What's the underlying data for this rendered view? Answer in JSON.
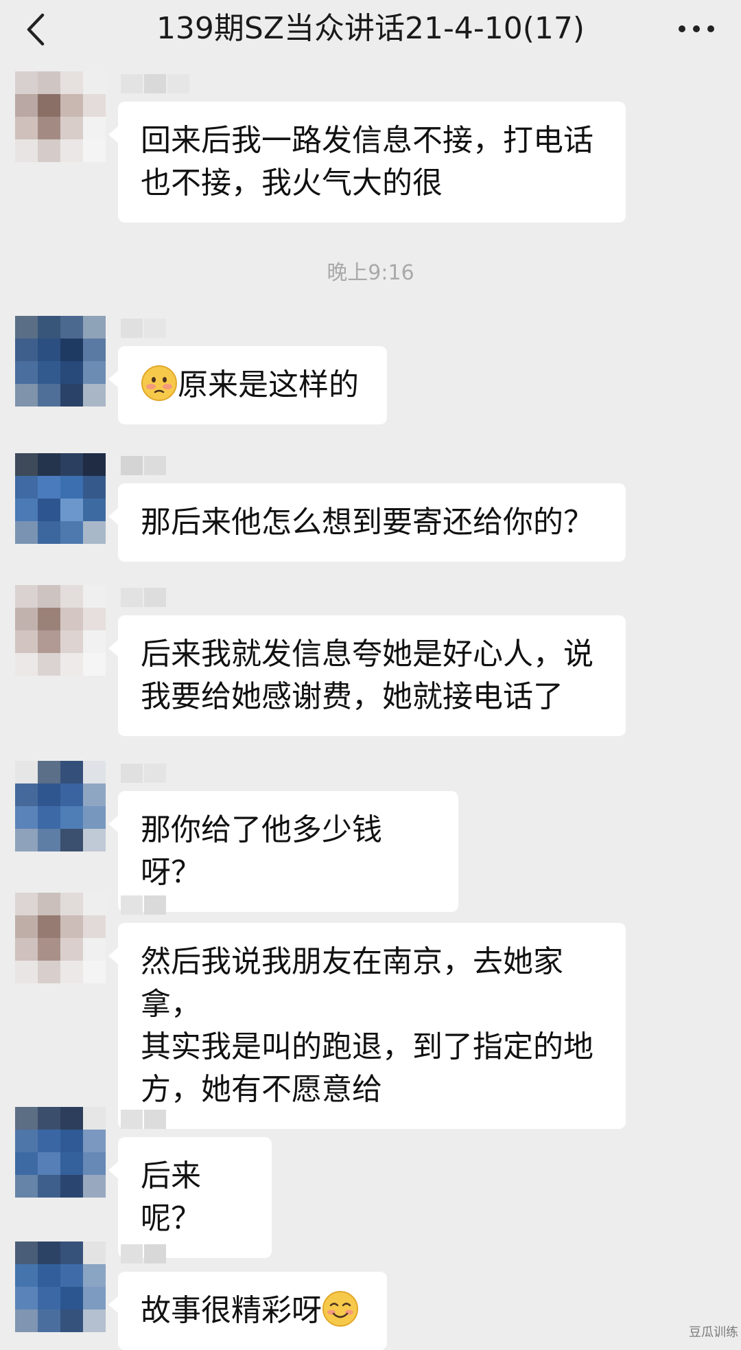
{
  "header": {
    "title": "139期SZ当众讲话21-4-10(17)",
    "back_icon": "chevron-left-icon",
    "more_icon": "ellipsis-icon"
  },
  "timestamp": "晚上9:16",
  "messages": [
    {
      "text": "回来后我一路发信息不接，打电话\n也不接，我火气大的很"
    },
    {
      "text": "原来是这样的",
      "emoji": "flushed-face-emoji"
    },
    {
      "text": "那后来他怎么想到要寄还给你的？"
    },
    {
      "text": "后来我就发信息夸她是好心人，说\n我要给她感谢费，她就接电话了"
    },
    {
      "text": "那你给了他多少钱呀？"
    },
    {
      "text": "然后我说我朋友在南京，去她家拿，\n其实我是叫的跑退，到了指定的地\n方，她有不愿意给"
    },
    {
      "text": "后来呢？"
    },
    {
      "text": "故事很精彩呀",
      "emoji": "smiling-face-emoji"
    }
  ],
  "watermark": "豆瓜训练",
  "colors": {
    "background": "#ededed",
    "bubble": "#ffffff",
    "timestamp": "#a9a9a9",
    "avatar_blue": "#3f6fa7",
    "avatar_skin": "#b79a8c"
  }
}
